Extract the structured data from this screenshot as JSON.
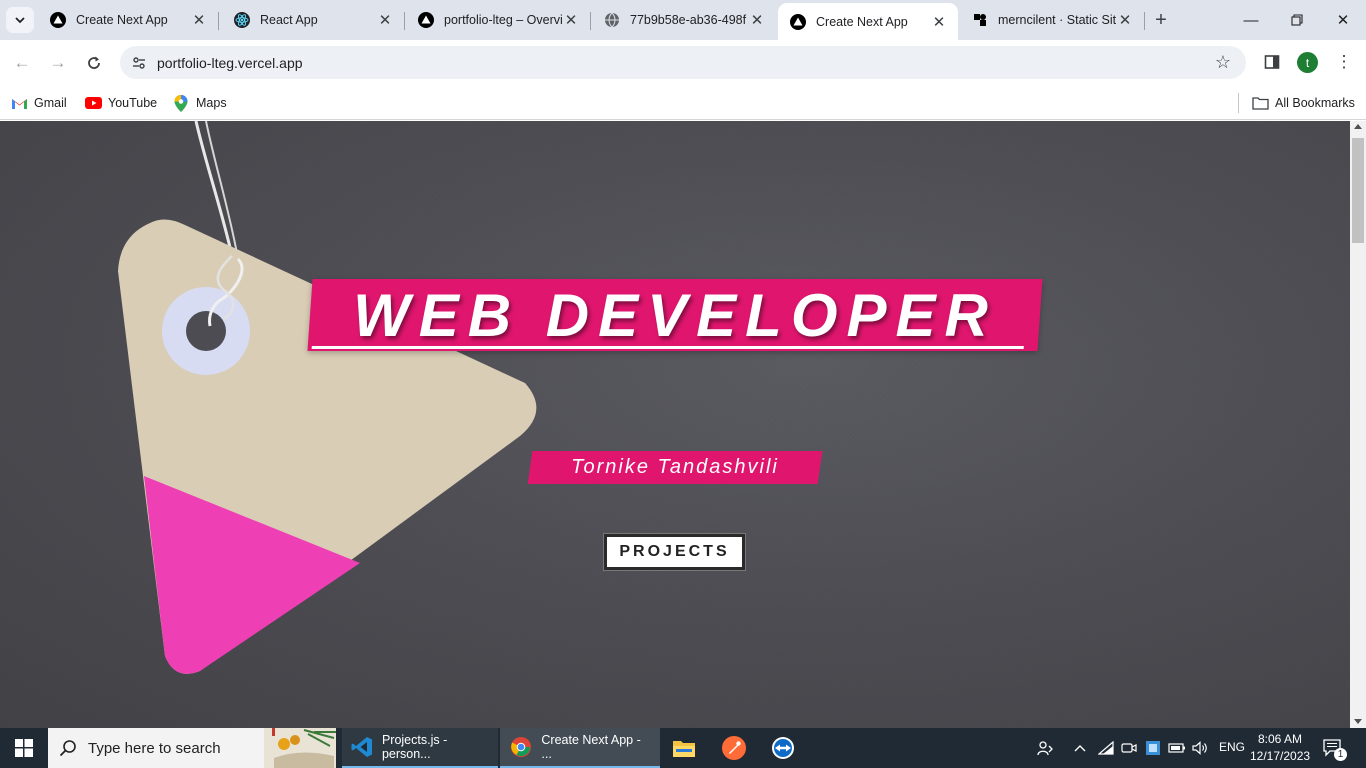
{
  "browser": {
    "tabs": [
      {
        "title": "Create Next App",
        "favicon": "vercel-triangle-icon",
        "active": false
      },
      {
        "title": "React App",
        "favicon": "react-icon",
        "active": false
      },
      {
        "title": "portfolio-lteg – Overview",
        "favicon": "vercel-triangle-icon",
        "active": false
      },
      {
        "title": "77b9b58e-ab36-498f",
        "favicon": "globe-icon",
        "active": false
      },
      {
        "title": "Create Next App",
        "favicon": "vercel-triangle-icon",
        "active": true
      },
      {
        "title": "merncilent · Static Site",
        "favicon": "render-icon",
        "active": false
      }
    ],
    "url": "portfolio-lteg.vercel.app",
    "profile_initial": "t",
    "bookmarks": [
      {
        "label": "Gmail",
        "icon": "gmail-icon"
      },
      {
        "label": "YouTube",
        "icon": "youtube-icon"
      },
      {
        "label": "Maps",
        "icon": "maps-icon"
      }
    ],
    "all_bookmarks_label": "All Bookmarks"
  },
  "page": {
    "headline": "WEB DEVELOPER",
    "name": "Tornike Tandashvili",
    "cta_label": "PROJECTS",
    "colors": {
      "accent": "#e0166e",
      "background": "#4d4d53",
      "tag": "#d9cdb6",
      "tag_stripe": "#ee3fb4"
    }
  },
  "taskbar": {
    "search_placeholder": "Type here to search",
    "apps": [
      {
        "label": "Projects.js - person...",
        "icon": "vscode-icon"
      },
      {
        "label": "Create Next App - ...",
        "icon": "chrome-icon"
      }
    ],
    "pinned": [
      "file-explorer-icon",
      "postman-icon",
      "teamviewer-icon"
    ],
    "language": "ENG",
    "time": "8:06 AM",
    "date": "12/17/2023",
    "notification_count": "1"
  }
}
